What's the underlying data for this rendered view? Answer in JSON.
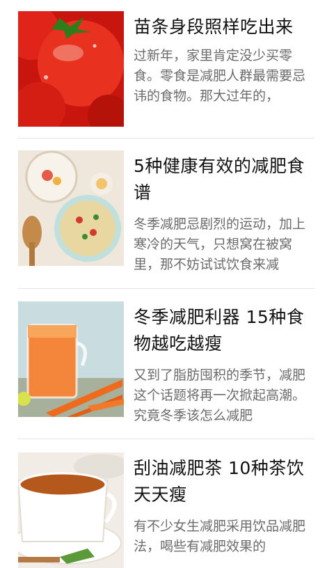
{
  "articles": [
    {
      "title": "苗条身段照样吃出来",
      "snippet": "过新年，家里肯定没少买零食。零食是减肥人群最需要忌讳的食物。那大过年的，",
      "image": "tomato-image"
    },
    {
      "title": "5种健康有效的减肥食谱",
      "snippet": "冬季减肥忌剧烈的运动，加上寒冷的天气，只想窝在被窝里，那不妨试试饮食来减",
      "image": "soup-bowls-image"
    },
    {
      "title": "冬季减肥利器 15种食物越吃越瘦",
      "snippet": "又到了脂肪囤积的季节，减肥这个话题将再一次掀起高潮。究竟冬季该怎么减肥",
      "image": "carrot-juice-image"
    },
    {
      "title": "刮油减肥茶 10种茶饮天天瘦",
      "snippet": "有不少女生减肥采用饮品减肥法，喝些有减肥效果的",
      "image": "tea-cup-image"
    }
  ]
}
